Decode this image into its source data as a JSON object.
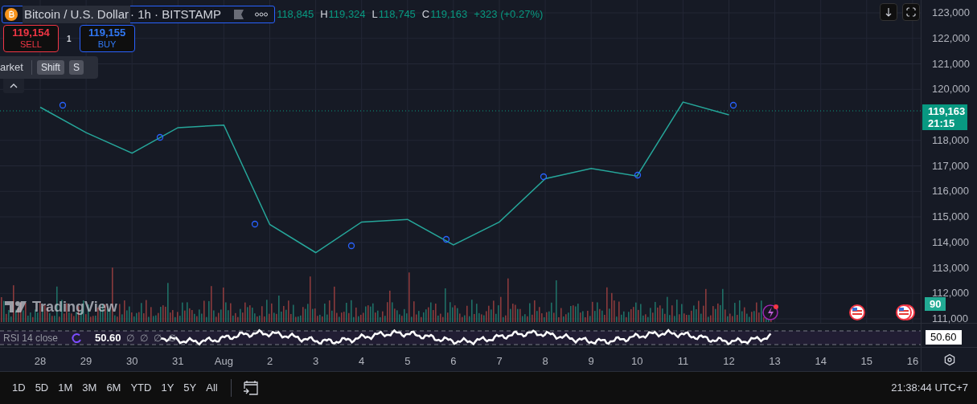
{
  "legend": {
    "symbol": "Bitcoin / U.S. Dollar",
    "interval": "· 1h · BITSTAMP",
    "ohlc": [
      {
        "value": "118,845"
      },
      {
        "label": "H",
        "value": "119,324"
      },
      {
        "label": "L",
        "value": "118,745"
      },
      {
        "label": "C",
        "value": "119,163"
      }
    ],
    "change": "+323 (+0.27%)"
  },
  "trade": {
    "sell": {
      "price": "119,154",
      "label": "SELL"
    },
    "quantity": "1",
    "buy": {
      "price": "119,155",
      "label": "BUY"
    }
  },
  "shortcut_tooltip": {
    "text": "arket",
    "keys": [
      "Shift",
      "S"
    ]
  },
  "price_chart": {
    "chart_data": {
      "type": "line",
      "categories": [
        "28",
        "29",
        "30",
        "31",
        "Aug",
        "2",
        "3",
        "4",
        "5",
        "6",
        "7",
        "8",
        "9",
        "10",
        "11",
        "12",
        "13",
        "14",
        "15",
        "16"
      ],
      "series": [
        {
          "color": "#26a69a",
          "values": [
            119300,
            118300,
            117500,
            118500,
            118600,
            114700,
            113600,
            114800,
            114900,
            113900,
            114800,
            116500,
            116900,
            116600,
            119500,
            119000,
            null,
            null,
            null,
            null
          ]
        }
      ],
      "ylim": [
        110843,
        123504
      ],
      "grid": true,
      "yticks": [
        {
          "value": 111000,
          "label": "111,000"
        },
        {
          "value": 112000,
          "label": "112,000"
        },
        {
          "value": 113000,
          "label": "113,000"
        },
        {
          "value": 114000,
          "label": "114,000"
        },
        {
          "value": 115000,
          "label": "115,000"
        },
        {
          "value": 116000,
          "label": "116,000"
        },
        {
          "value": 117000,
          "label": "117,000"
        },
        {
          "value": 118000,
          "label": "118,000"
        },
        {
          "value": 120000,
          "label": "120,000"
        },
        {
          "value": 121000,
          "label": "121,000"
        },
        {
          "value": 122000,
          "label": "122,000"
        },
        {
          "value": 123000,
          "label": "123,000"
        }
      ]
    }
  },
  "current_price": {
    "price": "119,163",
    "countdown": "21:15"
  },
  "volume_badge": "90",
  "rsi": {
    "title": "RSI 14 close",
    "value": "50.60",
    "hidden_values": "∅ ∅ ∅ ∅",
    "badge": "50.60"
  },
  "logo": "TradingView",
  "ranges": [
    {
      "label": "1D",
      "selected": false
    },
    {
      "label": "5D",
      "selected": false
    },
    {
      "label": "1M",
      "selected": false
    },
    {
      "label": "3M",
      "selected": false
    },
    {
      "label": "6M",
      "selected": false
    },
    {
      "label": "YTD",
      "selected": false
    },
    {
      "label": "1Y",
      "selected": false
    },
    {
      "label": "5Y",
      "selected": false
    },
    {
      "label": "All",
      "selected": false
    }
  ],
  "clock": "21:38:44 UTC+7"
}
